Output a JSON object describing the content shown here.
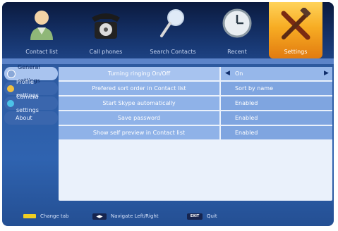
{
  "tabs": [
    {
      "label": "Contact list",
      "icon": "contact-icon"
    },
    {
      "label": "Call phones",
      "icon": "phone-icon"
    },
    {
      "label": "Search Contacts",
      "icon": "search-icon"
    },
    {
      "label": "Recent",
      "icon": "clock-icon"
    },
    {
      "label": "Settings",
      "icon": "tools-icon"
    }
  ],
  "active_tab": "Settings",
  "sidebar": {
    "items": [
      {
        "label": "General settings",
        "icon": "gear-icon",
        "color": "#8aa8d8"
      },
      {
        "label": "Profile settings",
        "icon": "profile-icon",
        "color": "#f0c040"
      },
      {
        "label": "Camera settings",
        "icon": "camera-icon",
        "color": "#4cc3e8"
      },
      {
        "label": "About",
        "icon": "",
        "color": ""
      }
    ],
    "active": "General settings"
  },
  "settings": [
    {
      "label": "Turning ringing On/Off",
      "value": "On"
    },
    {
      "label": "Prefered sort order in Contact list",
      "value": "Sort by name"
    },
    {
      "label": "Start Skype automatically",
      "value": "Enabled"
    },
    {
      "label": "Save password",
      "value": "Enabled"
    },
    {
      "label": "Show self preview in Contact list",
      "value": "Enabled"
    }
  ],
  "footer": {
    "change_tab": "Change tab",
    "navigate": "Navigate Left/Right",
    "exit_key": "EXIT",
    "quit": "Quit"
  },
  "colors": {
    "accent": "#f7ac23",
    "panel": "#eaf1fb",
    "row": "#8fb2e8",
    "yellow_key": "#f0cf22"
  }
}
